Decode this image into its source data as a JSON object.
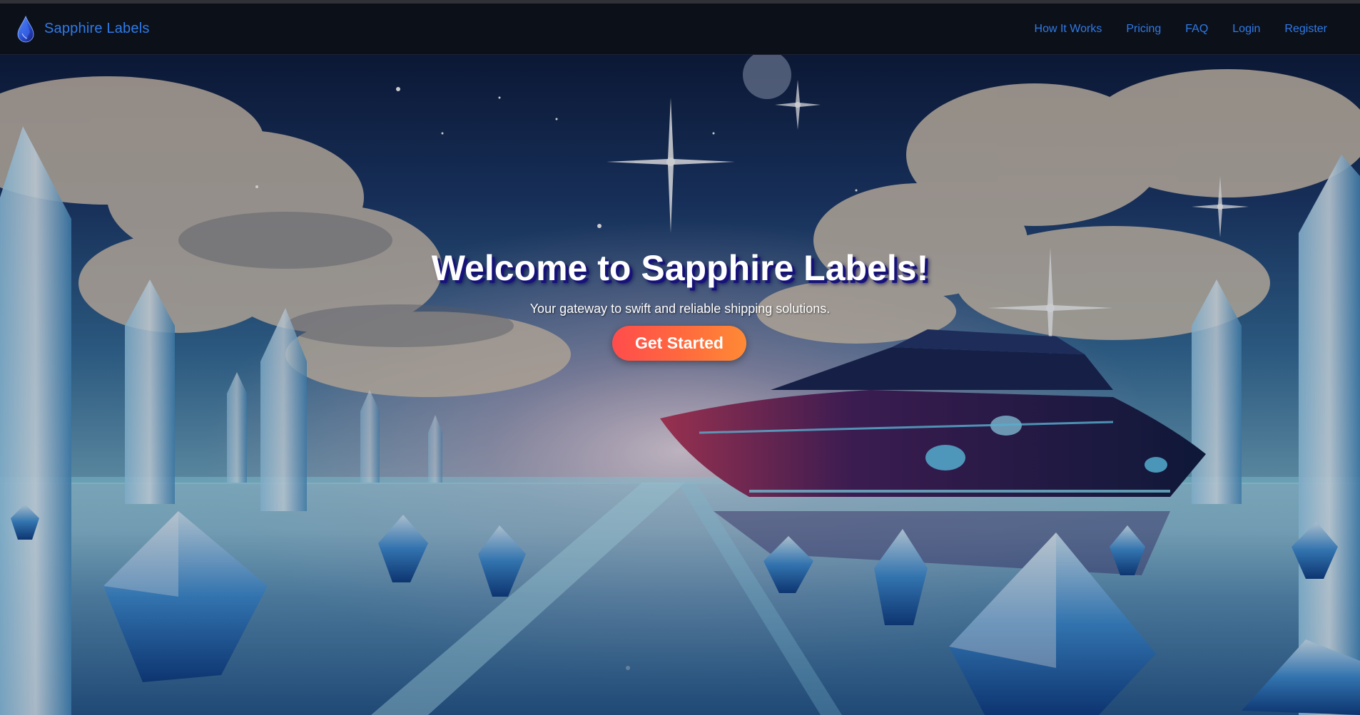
{
  "header": {
    "brand_name": "Sapphire Labels",
    "logo_icon": "sapphire-drop-icon",
    "nav_links": [
      {
        "label": "How It Works"
      },
      {
        "label": "Pricing"
      },
      {
        "label": "FAQ"
      },
      {
        "label": "Login"
      },
      {
        "label": "Register"
      }
    ]
  },
  "hero": {
    "title": "Welcome to Sapphire Labels!",
    "subtitle": "Your gateway to swift and reliable shipping solutions.",
    "cta_label": "Get Started",
    "background_image": "crystal-landscape-with-yacht"
  },
  "colors": {
    "nav_background": "#0c1019",
    "link": "#2f7be8",
    "cta_gradient_start": "#ff4c4c",
    "cta_gradient_end": "#ff8a35",
    "title_shadow": "#16127a"
  }
}
